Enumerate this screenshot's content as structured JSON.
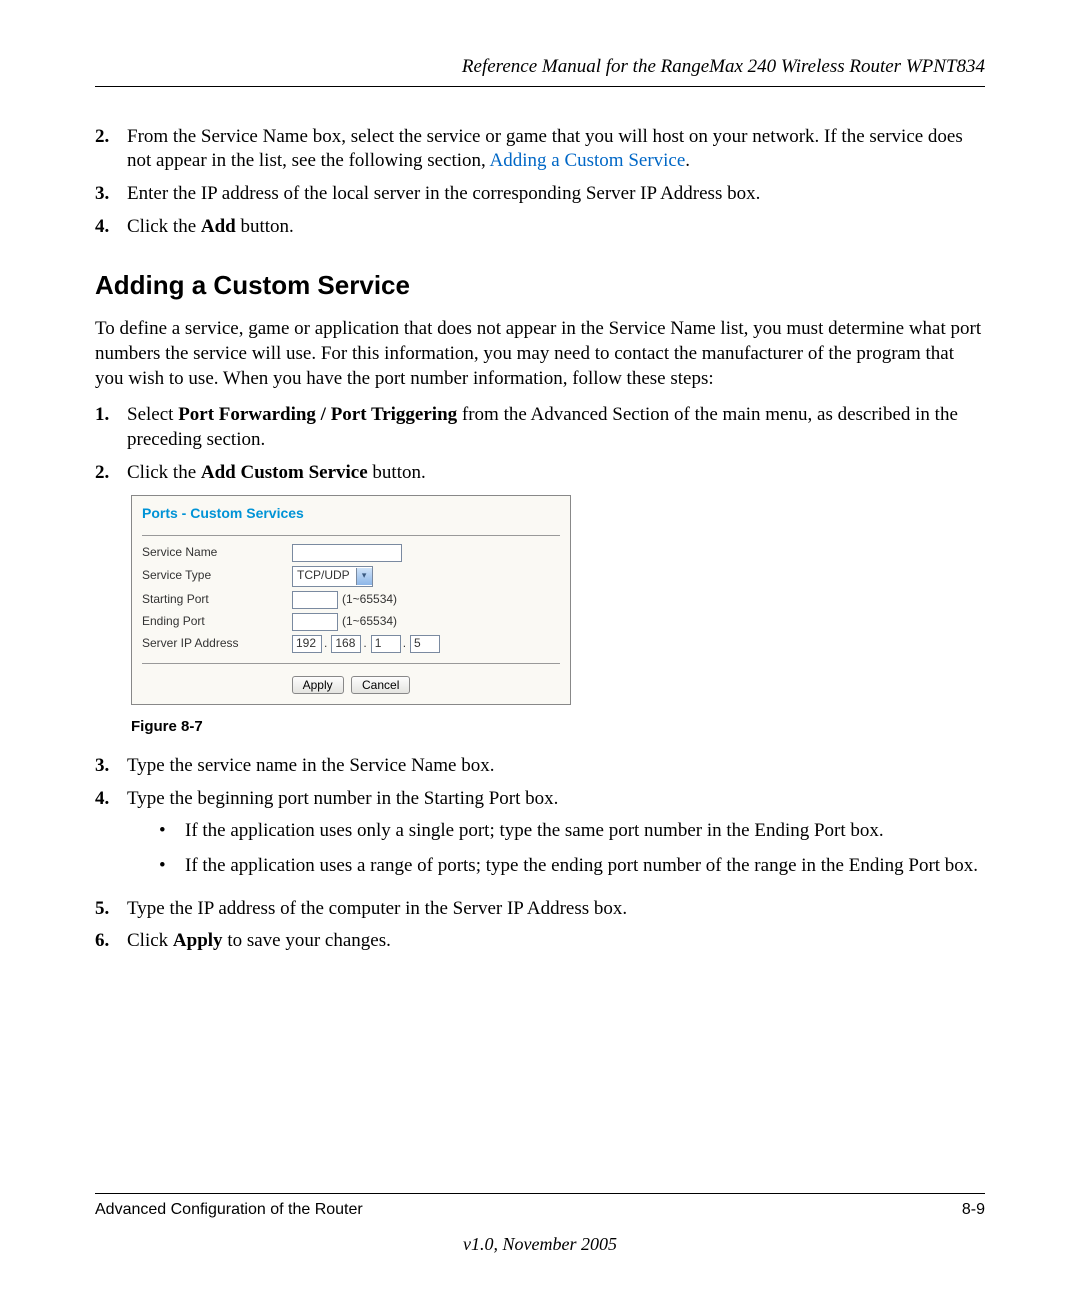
{
  "header": "Reference Manual for the RangeMax 240 Wireless Router WPNT834",
  "top_steps": [
    {
      "num": "2.",
      "pre": "From the Service Name box, select the service or game that you will host on your network. If the service does not appear in the list, see the following section, ",
      "link": "Adding a Custom Service",
      "post": "."
    },
    {
      "num": "3.",
      "text": "Enter the IP address of the local server in the corresponding Server IP Address box."
    },
    {
      "num": "4.",
      "pre": "Click the ",
      "bold": "Add",
      "post": " button."
    }
  ],
  "section_heading": "Adding a Custom Service",
  "intro": "To define a service, game or application that does not appear in the Service Name list, you must determine what port numbers the service will use. For this information, you may need to contact the manufacturer of the program that you wish to use. When you have the port number information, follow these steps:",
  "steps2": {
    "s1": {
      "num": "1.",
      "pre": "Select ",
      "bold": "Port Forwarding / Port Triggering",
      "post": " from the Advanced Section of the main menu, as described in the preceding section."
    },
    "s2": {
      "num": "2.",
      "pre": "Click the ",
      "bold": "Add Custom Service",
      "post": " button."
    }
  },
  "panel": {
    "title": "Ports - Custom Services",
    "labels": {
      "service_name": "Service Name",
      "service_type": "Service Type",
      "starting_port": "Starting Port",
      "ending_port": "Ending Port",
      "server_ip": "Server IP Address"
    },
    "service_type_value": "TCP/UDP",
    "port_hint": "(1~65534)",
    "ip": {
      "o1": "192",
      "o2": "168",
      "o3": "1",
      "o4": "5"
    },
    "apply": "Apply",
    "cancel": "Cancel"
  },
  "figure_caption": "Figure 8-7",
  "steps3": {
    "s3": {
      "num": "3.",
      "text": "Type the service name in the Service Name box."
    },
    "s4": {
      "num": "4.",
      "text": "Type the beginning port number in the Starting Port box."
    },
    "bullets": [
      "If the application uses only a single port; type the same port number in the Ending Port box.",
      "If the application uses a range of ports; type the ending port number of the range in the Ending Port box."
    ],
    "s5": {
      "num": "5.",
      "text": "Type the IP address of the computer in the Server IP Address box."
    },
    "s6": {
      "num": "6.",
      "pre": "Click ",
      "bold": "Apply",
      "post": " to save your changes."
    }
  },
  "footer": {
    "left": "Advanced Configuration of the Router",
    "right": "8-9",
    "version": "v1.0, November 2005"
  }
}
